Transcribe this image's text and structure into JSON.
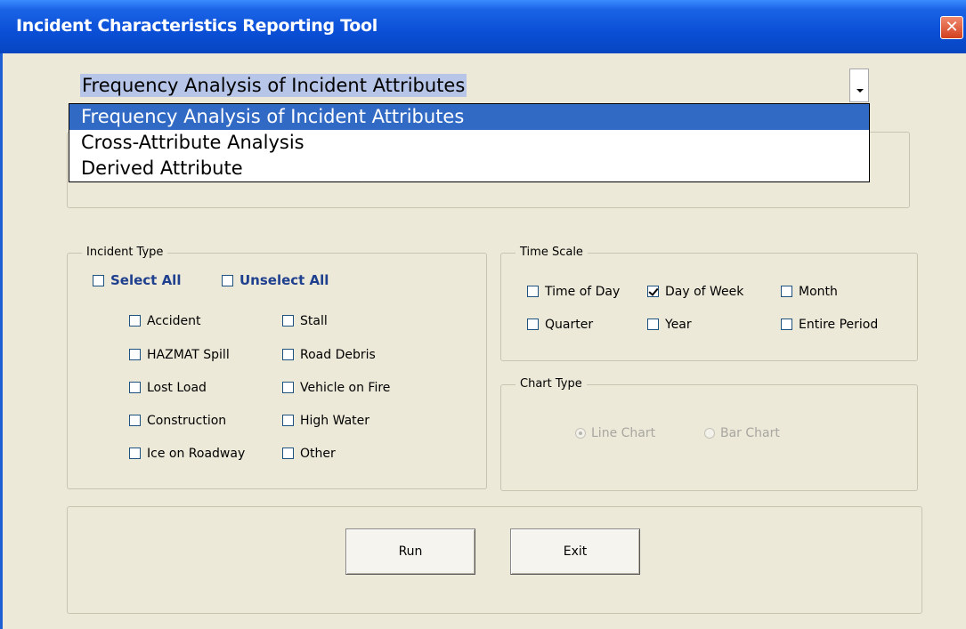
{
  "window": {
    "title": "Incident Characteristics Reporting Tool"
  },
  "analysis": {
    "selected": "Frequency Analysis of Incident Attributes",
    "options": [
      "Frequency Analysis of Incident Attributes",
      "Cross-Attribute Analysis",
      "Derived Attribute"
    ]
  },
  "incident_type": {
    "label": "Incident Type",
    "select_all": "Select All",
    "unselect_all": "Unselect All",
    "items": [
      {
        "label": "Accident",
        "checked": false
      },
      {
        "label": "Stall",
        "checked": false
      },
      {
        "label": "HAZMAT Spill",
        "checked": false
      },
      {
        "label": "Road Debris",
        "checked": false
      },
      {
        "label": "Lost Load",
        "checked": false
      },
      {
        "label": "Vehicle on Fire",
        "checked": false
      },
      {
        "label": "Construction",
        "checked": false
      },
      {
        "label": "High Water",
        "checked": false
      },
      {
        "label": "Ice on Roadway",
        "checked": false
      },
      {
        "label": "Other",
        "checked": false
      }
    ]
  },
  "time_scale": {
    "label": "Time Scale",
    "items": [
      {
        "label": "Time of Day",
        "checked": false
      },
      {
        "label": "Day of Week",
        "checked": true
      },
      {
        "label": "Month",
        "checked": false
      },
      {
        "label": "Quarter",
        "checked": false
      },
      {
        "label": "Year",
        "checked": false
      },
      {
        "label": "Entire Period",
        "checked": false
      }
    ]
  },
  "chart_type": {
    "label": "Chart Type",
    "options": [
      {
        "label": "Line Chart",
        "selected": true,
        "enabled": false
      },
      {
        "label": "Bar Chart",
        "selected": false,
        "enabled": false
      }
    ]
  },
  "buttons": {
    "run": "Run",
    "exit": "Exit"
  }
}
